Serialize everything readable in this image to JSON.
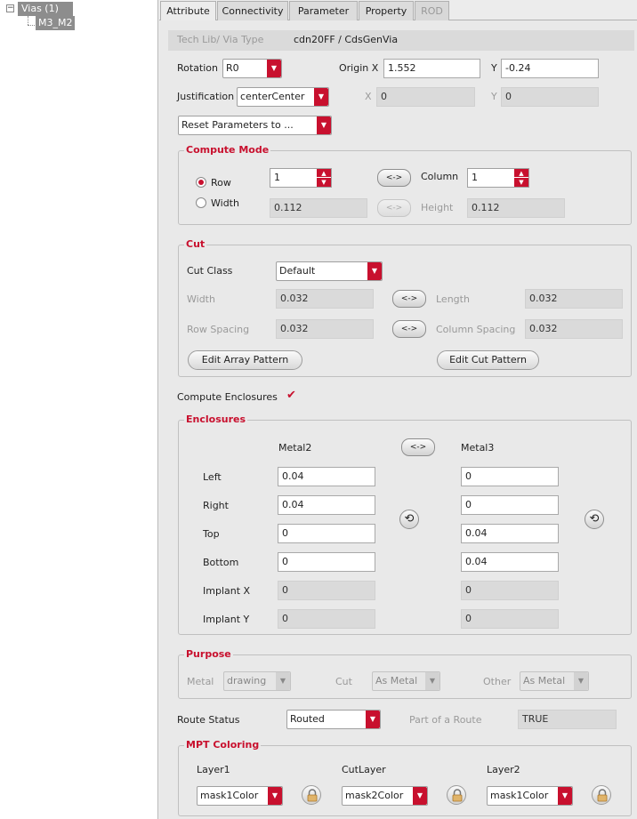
{
  "tree": {
    "root": "Vias (1)",
    "child": "M3_M2"
  },
  "tabs": [
    "Attribute",
    "Connectivity",
    "Parameter",
    "Property",
    "ROD"
  ],
  "header": {
    "tech_label": "Tech Lib/ Via Type",
    "tech_value": "cdn20FF / CdsGenVia",
    "rotation_label": "Rotation",
    "rotation_value": "R0",
    "origin_x_label": "Origin X",
    "origin_x_value": "1.552",
    "origin_y_label": "Y",
    "origin_y_value": "-0.24",
    "justification_label": "Justification",
    "justification_value": "centerCenter",
    "just_x_label": "X",
    "just_x_value": "0",
    "just_y_label": "Y",
    "just_y_value": "0",
    "reset_value": "Reset Parameters to ..."
  },
  "compute_mode": {
    "title": "Compute Mode",
    "row_label": "Row",
    "row_value": "1",
    "width_label": "Width",
    "width_value": "0.112",
    "column_label": "Column",
    "column_value": "1",
    "height_label": "Height",
    "height_value": "0.112",
    "swap_label": "<->"
  },
  "cut": {
    "title": "Cut",
    "cut_class_label": "Cut Class",
    "cut_class_value": "Default",
    "width_label": "Width",
    "width_value": "0.032",
    "length_label": "Length",
    "length_value": "0.032",
    "row_spacing_label": "Row Spacing",
    "row_spacing_value": "0.032",
    "column_spacing_label": "Column Spacing",
    "column_spacing_value": "0.032",
    "swap_label": "<->",
    "edit_array_label": "Edit Array Pattern",
    "edit_cut_label": "Edit Cut Pattern"
  },
  "compute_enclosures": {
    "label": "Compute Enclosures",
    "checked": true,
    "mark": "✔"
  },
  "enclosures": {
    "title": "Enclosures",
    "col1": "Metal2",
    "col2": "Metal3",
    "swap_label": "<->",
    "rotate_glyph": "⟲",
    "rows": [
      {
        "label": "Left",
        "m2": "0.04",
        "m3": "0"
      },
      {
        "label": "Right",
        "m2": "0.04",
        "m3": "0"
      },
      {
        "label": "Top",
        "m2": "0",
        "m3": "0.04"
      },
      {
        "label": "Bottom",
        "m2": "0",
        "m3": "0.04"
      },
      {
        "label": "Implant X",
        "m2": "0",
        "m3": "0"
      },
      {
        "label": "Implant Y",
        "m2": "0",
        "m3": "0"
      }
    ]
  },
  "purpose": {
    "title": "Purpose",
    "metal_label": "Metal",
    "metal_value": "drawing",
    "cut_label": "Cut",
    "cut_value": "As Metal",
    "other_label": "Other",
    "other_value": "As Metal"
  },
  "route": {
    "status_label": "Route Status",
    "status_value": "Routed",
    "part_label": "Part of a Route",
    "part_value": "TRUE"
  },
  "mpt": {
    "title": "MPT Coloring",
    "layer1_label": "Layer1",
    "layer1_value": "mask1Color",
    "cutlayer_label": "CutLayer",
    "cutlayer_value": "mask2Color",
    "layer2_label": "Layer2",
    "layer2_value": "mask1Color"
  },
  "colors": {
    "accent": "#c8102e",
    "selection": "#8d8d8d",
    "panel": "#e9e9e9"
  }
}
